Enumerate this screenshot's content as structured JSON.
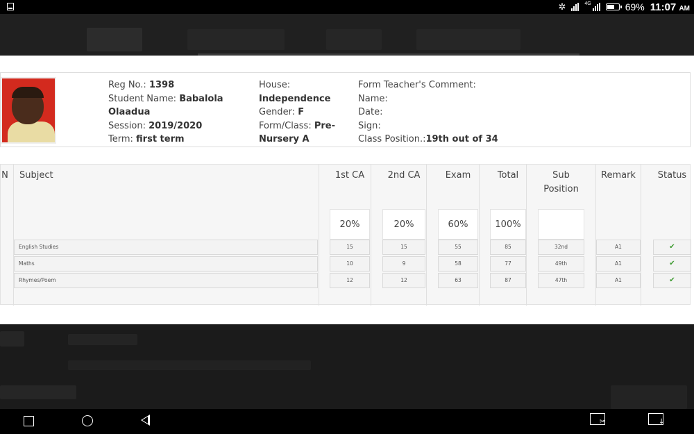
{
  "status_bar": {
    "battery": "69%",
    "network": "4G",
    "time": "11:07",
    "ampm": "AM"
  },
  "student": {
    "reg_label": "Reg No.:",
    "reg_value": "1398",
    "name_label": "Student Name:",
    "name_value_1": "Babalola",
    "name_value_2": "Olaadua",
    "session_label": "Session:",
    "session_value": "2019/2020",
    "term_label": "Term:",
    "term_value": "first term",
    "house_label": "House:",
    "house_value": "Independence",
    "gender_label": "Gender:",
    "gender_value": "F",
    "class_label": "Form/Class:",
    "class_value_1": "Pre-",
    "class_value_2": "Nursery A",
    "comment_label": "Form Teacher's Comment:",
    "name2_label": "Name:",
    "date_label": "Date:",
    "sign_label": "Sign:",
    "position_label": "Class Position.:",
    "position_value": "19th out of 34"
  },
  "table": {
    "headers": {
      "sn": "N",
      "subject": "Subject",
      "ca1": "1st CA",
      "ca2": "2nd CA",
      "exam": "Exam",
      "total": "Total",
      "sub_position_1": "Sub",
      "sub_position_2": "Position",
      "remark": "Remark",
      "status": "Status"
    },
    "weights": {
      "ca1": "20%",
      "ca2": "20%",
      "exam": "60%",
      "total": "100%"
    },
    "rows": [
      {
        "subject": "English Studies",
        "ca1": "15",
        "ca2": "15",
        "exam": "55",
        "total": "85",
        "position": "32nd",
        "remark": "A1",
        "status": "passed"
      },
      {
        "subject": "Maths",
        "ca1": "10",
        "ca2": "9",
        "exam": "58",
        "total": "77",
        "position": "49th",
        "remark": "A1",
        "status": "passed"
      },
      {
        "subject": "Rhymes/Poem",
        "ca1": "12",
        "ca2": "12",
        "exam": "63",
        "total": "87",
        "position": "47th",
        "remark": "A1",
        "status": "passed"
      }
    ]
  },
  "icons": {
    "status_pass": "check-icon",
    "nav_recent": "square-icon",
    "nav_home": "circle-icon",
    "nav_back": "triangle-back-icon",
    "screenshot": "screenshot-icon"
  }
}
